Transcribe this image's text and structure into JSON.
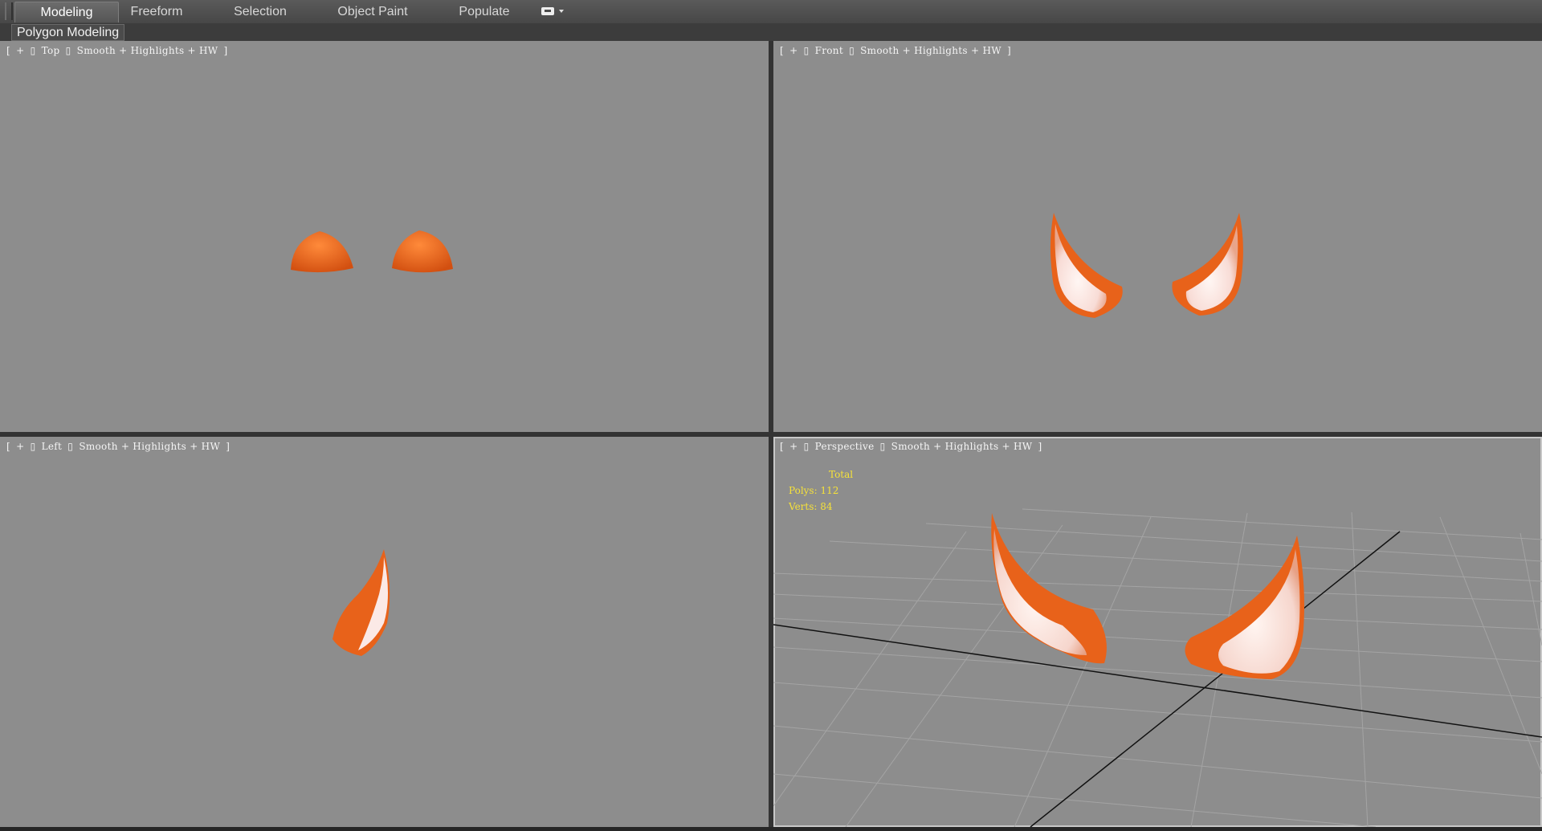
{
  "ribbon": {
    "tabs": [
      {
        "label": "Modeling",
        "active": true
      },
      {
        "label": "Freeform"
      },
      {
        "label": "Selection"
      },
      {
        "label": "Object Paint"
      },
      {
        "label": "Populate"
      }
    ],
    "panel_label": "Polygon Modeling",
    "tools_icon": "ribbon-options-icon"
  },
  "viewports": {
    "top": {
      "bracket_open": "[",
      "plus": "+",
      "name": "Top",
      "mode": "Smooth + Highlights + HW",
      "bracket_close": "]"
    },
    "front": {
      "bracket_open": "[",
      "plus": "+",
      "name": "Front",
      "mode": "Smooth + Highlights + HW",
      "bracket_close": "]"
    },
    "left": {
      "bracket_open": "[",
      "plus": "+",
      "name": "Left",
      "mode": "Smooth + Highlights + HW",
      "bracket_close": "]"
    },
    "perspective": {
      "bracket_open": "[",
      "plus": "+",
      "name": "Perspective",
      "mode": "Smooth + Highlights + HW",
      "bracket_close": "]"
    }
  },
  "stats": {
    "title": "Total",
    "polys": "Polys:  112",
    "verts": "Verts:  84"
  },
  "colors": {
    "viewport_bg": "#8d8d8d",
    "ear_orange": "#e8621a",
    "ear_inner": "#fbe9e6",
    "stats_yellow": "#f5e13a"
  }
}
